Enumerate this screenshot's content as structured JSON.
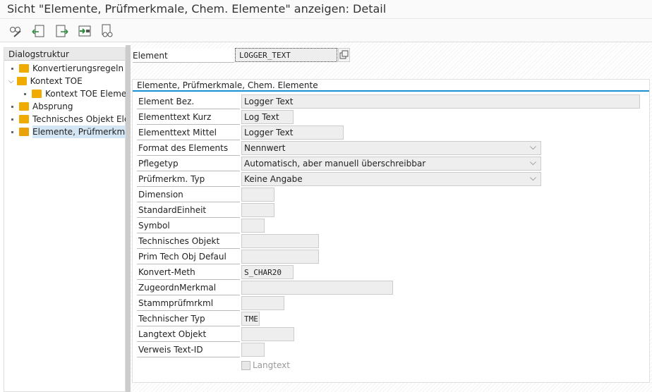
{
  "title": "Sicht \"Elemente, Prüfmerkmale, Chem. Elemente\" anzeigen: Detail",
  "toolbar": [
    "display-change-icon",
    "previous-entry-icon",
    "next-entry-icon",
    "other-entry-icon",
    "where-used-icon"
  ],
  "dialog": {
    "header": "Dialogstruktur",
    "items": [
      {
        "label": "Konvertierungsregeln",
        "level": 0
      },
      {
        "label": "Kontext TOE",
        "level": 0,
        "expanded": true
      },
      {
        "label": "Kontext TOE Elemente",
        "level": 1
      },
      {
        "label": "Absprung",
        "level": 0
      },
      {
        "label": "Technisches Objekt Elemente",
        "level": 0
      },
      {
        "label": "Elemente, Prüfmerkmale, Chem. Elemente",
        "level": 0,
        "selected": true
      }
    ]
  },
  "element": {
    "label": "Element",
    "value": "LOGGER_TEXT"
  },
  "group": {
    "title": "Elemente, Prüfmerkmale, Chem. Elemente",
    "fields": [
      {
        "label": "Element Bez.",
        "value": "Logger Text"
      },
      {
        "label": "Elementtext Kurz",
        "value": "Log Text"
      },
      {
        "label": "Elementtext Mittel",
        "value": "Logger Text"
      },
      {
        "label": "Format des Elements",
        "value": "Nennwert"
      },
      {
        "label": "Pflegetyp",
        "value": "Automatisch, aber manuell überschreibbar"
      },
      {
        "label": "Prüfmerkm. Typ",
        "value": "Keine Angabe"
      },
      {
        "label": "Dimension",
        "value": ""
      },
      {
        "label": "StandardEinheit",
        "value": ""
      },
      {
        "label": "Symbol",
        "value": ""
      },
      {
        "label": "Technisches Objekt",
        "value": ""
      },
      {
        "label": "Prim Tech Obj Defaul",
        "value": ""
      },
      {
        "label": "Konvert-Meth",
        "value": "S_CHAR20"
      },
      {
        "label": "ZugeordnMerkmal",
        "value": ""
      },
      {
        "label": "Stammprüfmrkml",
        "value": ""
      },
      {
        "label": "Technischer Typ",
        "value": "TME"
      },
      {
        "label": "Langtext Objekt",
        "value": ""
      },
      {
        "label": "Verweis Text-ID",
        "value": ""
      }
    ],
    "checkbox": {
      "label": "Langtext",
      "checked": false
    }
  }
}
